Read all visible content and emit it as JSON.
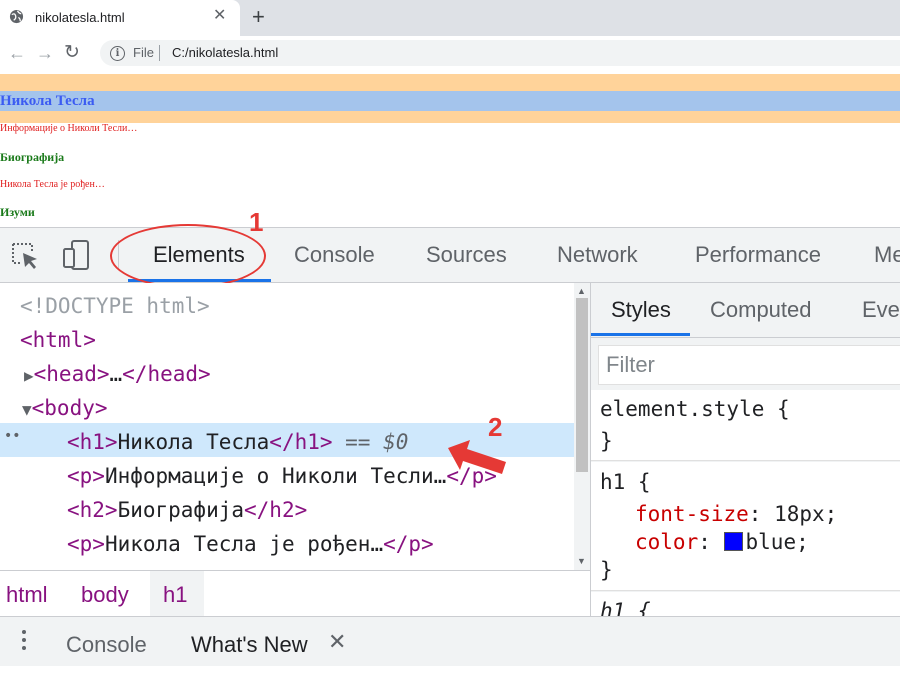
{
  "browser": {
    "tab_title": "nikolatesla.html",
    "close_glyph": "✕",
    "new_tab_glyph": "+",
    "back_glyph": "←",
    "forward_glyph": "→",
    "reload_glyph": "↻",
    "info_glyph": "i",
    "file_label": "File",
    "url": "C:/nikolatesla.html"
  },
  "page": {
    "h1": "Никола Тесла",
    "p1": "Информације о Николи Тесли…",
    "h2a": "Биографија",
    "p2": "Никола Тесла је рођен…",
    "h2b": "Изуми"
  },
  "devtools": {
    "tabs": [
      "Elements",
      "Console",
      "Sources",
      "Network",
      "Performance",
      "Me"
    ],
    "active_tab": "Elements",
    "dom": {
      "doctype": "<!DOCTYPE html>",
      "html_open": "<html>",
      "head_open": "<head>",
      "ellipsis": "…",
      "head_close": "</head>",
      "body_open": "<body>",
      "h1_open": "<h1>",
      "h1_text": "Никола Тесла",
      "h1_close": "</h1>",
      "h1_marker": " == $0",
      "p_open": "<p>",
      "p1_text": "Информације о Николи Тесли…",
      "p_close": "</p>",
      "h2_open": "<h2>",
      "h2_text": "Биографија",
      "h2_close": "</h2>",
      "p2_text": "Никола Тесла је рођен…",
      "collapsed_marker": "▶",
      "expanded_marker": "▼",
      "selected_dots": "••"
    },
    "breadcrumbs": [
      "html",
      "body",
      "h1"
    ],
    "styles_tabs": [
      "Styles",
      "Computed",
      "Eve"
    ],
    "filter_placeholder": "Filter",
    "element_style": {
      "selector": "element.style {",
      "close": "}"
    },
    "h1_rule": {
      "selector": "h1 {",
      "prop1": "font-size",
      "val1": "18px;",
      "prop2": "color",
      "val2": "blue;",
      "swatch_color": "#0000ff",
      "close": "}"
    },
    "next_rule_partial": "h1 {",
    "drawer": {
      "tabs": [
        "Console",
        "What's New"
      ],
      "close_glyph": "✕"
    }
  },
  "annotations": {
    "label1": "1",
    "label2": "2",
    "color": "#e53935"
  }
}
